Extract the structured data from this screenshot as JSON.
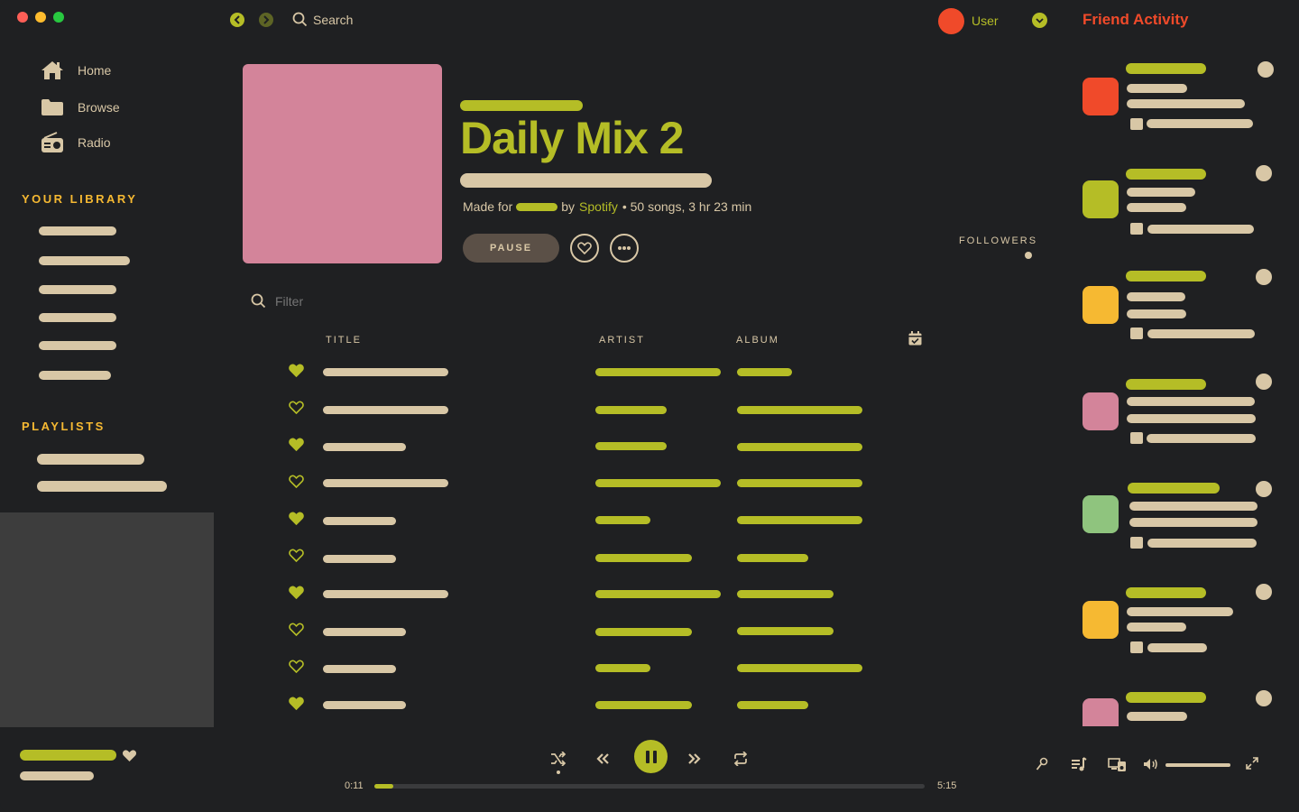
{
  "topbar": {
    "search_label": "Search",
    "user_label": "User"
  },
  "sidebar": {
    "items": [
      {
        "label": "Home",
        "icon": "home-icon"
      },
      {
        "label": "Browse",
        "icon": "folder-icon"
      },
      {
        "label": "Radio",
        "icon": "radio-icon"
      }
    ],
    "library_heading": "YOUR LIBRARY",
    "playlists_heading": "PLAYLISTS"
  },
  "header": {
    "title": "Daily Mix 2",
    "made_for_label": "Made for",
    "by_label": "by",
    "owner": "Spotify",
    "details": "• 50 songs, 3 hr 23 min",
    "pause_label": "PAUSE",
    "followers_label": "FOLLOWERS"
  },
  "tracklist": {
    "filter_placeholder": "Filter",
    "columns": {
      "title": "TITLE",
      "artist": "ARTIST",
      "album": "ALBUM"
    },
    "liked": [
      true,
      false,
      true,
      false,
      true,
      false,
      true,
      false,
      false,
      true
    ]
  },
  "friend_activity": {
    "title": "Friend Activity",
    "friend_colors": [
      "#f04a2a",
      "#b5bd26",
      "#f6b932",
      "#d3849a",
      "#8fc47e",
      "#f6b932",
      "#d3849a"
    ]
  },
  "player": {
    "elapsed": "0:11",
    "duration": "5:15",
    "progress": 0.035,
    "volume": 1.0
  },
  "colors": {
    "background": "#1f2022",
    "accent_lime": "#b5bd26",
    "text_tan": "#d8c7a6",
    "heading_orange": "#f6b932",
    "friend_title_red": "#f04a2a",
    "album_cover_pink": "#d3849a"
  }
}
